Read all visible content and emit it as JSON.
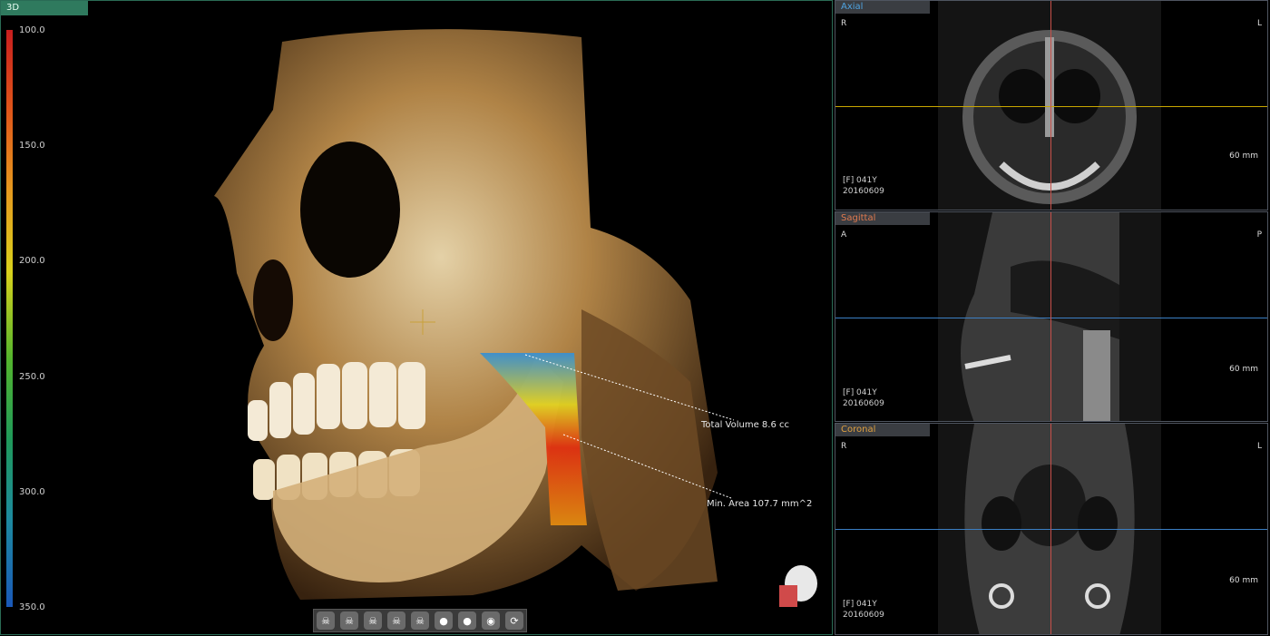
{
  "view3d": {
    "tab_label": "3D",
    "colorbar_ticks": [
      "100.0",
      "150.0",
      "200.0",
      "250.0",
      "300.0",
      "350.0"
    ],
    "measurements": {
      "total_volume": "Total Volume 8.6 cc",
      "min_area": "Min. Area 107.7 mm^2"
    },
    "toolbar": [
      "skull-front",
      "skull-left",
      "skull-right",
      "skull-top",
      "skull-bottom",
      "head-front",
      "head-back",
      "sphere",
      "rotate"
    ]
  },
  "axial": {
    "tab_label": "Axial",
    "left": "R",
    "right": "L",
    "scale": "60 mm",
    "info": [
      "[F] 041Y",
      "20160609"
    ]
  },
  "sagittal": {
    "tab_label": "Sagittal",
    "left": "A",
    "right": "P",
    "scale": "60 mm",
    "info": [
      "[F] 041Y",
      "20160609"
    ]
  },
  "coronal": {
    "tab_label": "Coronal",
    "left": "R",
    "right": "L",
    "scale": "60 mm",
    "info": [
      "[F] 041Y",
      "20160609"
    ]
  },
  "colors": {
    "accent": "#2f7a5e",
    "axial_line": "#c9a700",
    "sagittal_line": "#3b7fc4",
    "coronal_line": "#3b7fc4",
    "vertical_line": "#c8504a"
  }
}
